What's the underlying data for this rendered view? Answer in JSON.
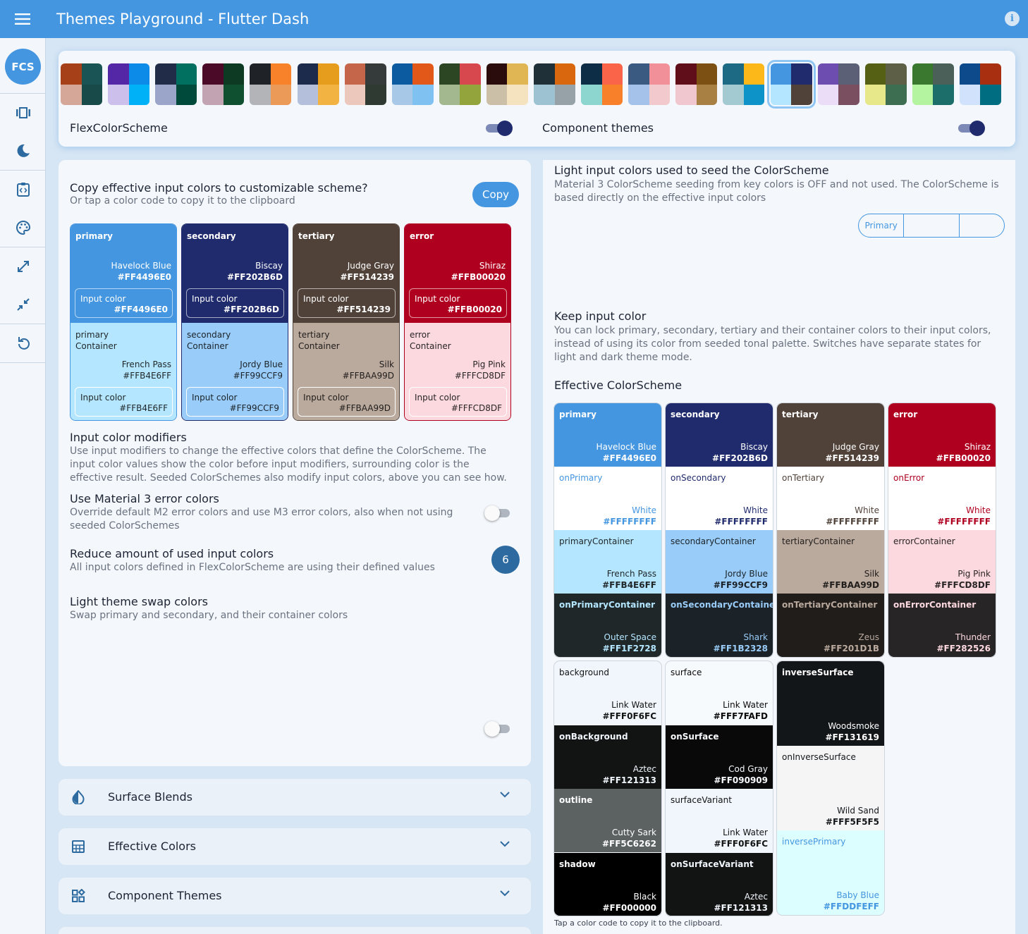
{
  "app": {
    "title": "Themes Playground - Flutter Dash",
    "logo": "FCS"
  },
  "icons": {
    "menu": "menu-icon",
    "info": "info-icon",
    "rail": [
      "view-carousel-icon",
      "dark-mode-icon",
      "code-icon",
      "palette-icon",
      "expand-icon",
      "collapse-icon",
      "reset-icon"
    ]
  },
  "schemes": [
    [
      "#a54018",
      "#1a5454",
      "#d4a798",
      "#184a4a"
    ],
    [
      "#5427a6",
      "#0c8be8",
      "#cdbfec",
      "#00b1f8"
    ],
    [
      "#202c48",
      "#027060",
      "#9aa5c9",
      "#004a3c"
    ],
    [
      "#4b0a28",
      "#0c3a23",
      "#c1a3b1",
      "#0f5030"
    ],
    [
      "#1f2328",
      "#f8822a",
      "#b3b4b8",
      "#ec9a58"
    ],
    [
      "#1c2b4c",
      "#e69d1d",
      "#b4c0db",
      "#f2b342"
    ],
    [
      "#c5664b",
      "#343b3a",
      "#ecc8bc",
      "#2f3a33"
    ],
    [
      "#0c5aa0",
      "#e25818",
      "#a8c8e8",
      "#7fc1f0"
    ],
    [
      "#2c4624",
      "#d6484e",
      "#a3b88f",
      "#92a43b"
    ],
    [
      "#2b0c0c",
      "#e0b655",
      "#cbbfa8",
      "#f4e3be"
    ],
    [
      "#203038",
      "#d8670e",
      "#9dc2d1",
      "#96a2a8"
    ],
    [
      "#0c2d45",
      "#fa6448",
      "#8cd6cf",
      "#f9802a"
    ],
    [
      "#3a5a82",
      "#f2909a",
      "#a5c2eb",
      "#f2c9cd"
    ],
    [
      "#600e1a",
      "#7c5012",
      "#f0c7ce",
      "#a88044"
    ],
    [
      "#1c6a84",
      "#fbb818",
      "#a3c9d1",
      "#0d93c8"
    ],
    [
      "#4496e0",
      "#202b6d",
      "#b4e6ff",
      "#514239"
    ],
    [
      "#6d4db0",
      "#5c6076",
      "#ebdcf8",
      "#7a5060"
    ],
    [
      "#566014",
      "#5d6046",
      "#e6e88a",
      "#3e6e52"
    ],
    [
      "#3a7830",
      "#4a6058",
      "#b4f4a0",
      "#1b6e6a"
    ],
    [
      "#0c4a8c",
      "#a83010",
      "#d0e2fc",
      "#006e80"
    ]
  ],
  "selected_scheme": 15,
  "top": {
    "left_label": "FlexColorScheme",
    "right_label": "Component themes",
    "left_switch": true,
    "right_switch": true
  },
  "left": {
    "copy_title": "Copy effective input colors to customizable scheme?",
    "copy_sub": "Or tap a color code to copy it to the clipboard",
    "copy_button": "Copy",
    "input_colors": [
      {
        "name": "primary",
        "bg": "#4496e0",
        "fg": "#ffffff",
        "color_name": "Havelock Blue",
        "hex": "#FF4496E0",
        "input_label": "Input color",
        "input_hex": "#FF4496E0",
        "c_name": "primary\nContainer",
        "c_bg": "#b4e6ff",
        "c_fg": "#1f2728",
        "c_color_name": "French Pass",
        "c_hex": "#FFB4E6FF",
        "c_input_label": "Input color",
        "c_input_hex": "#FFB4E6FF"
      },
      {
        "name": "secondary",
        "bg": "#202b6d",
        "fg": "#ffffff",
        "color_name": "Biscay",
        "hex": "#FF202B6D",
        "input_label": "Input color",
        "input_hex": "#FF202B6D",
        "c_name": "secondary\nContainer",
        "c_bg": "#99ccf9",
        "c_fg": "#1b2328",
        "c_color_name": "Jordy Blue",
        "c_hex": "#FF99CCF9",
        "c_input_label": "Input color",
        "c_input_hex": "#FF99CCF9"
      },
      {
        "name": "tertiary",
        "bg": "#514239",
        "fg": "#ffffff",
        "color_name": "Judge Gray",
        "hex": "#FF514239",
        "input_label": "Input color",
        "input_hex": "#FF514239",
        "c_name": "tertiary\nContainer",
        "c_bg": "#baa99d",
        "c_fg": "#201d1b",
        "c_color_name": "Silk",
        "c_hex": "#FFBAA99D",
        "c_input_label": "Input color",
        "c_input_hex": "#FFBAA99D"
      },
      {
        "name": "error",
        "bg": "#b00020",
        "fg": "#ffffff",
        "color_name": "Shiraz",
        "hex": "#FFB00020",
        "input_label": "Input color",
        "input_hex": "#FFB00020",
        "c_name": "error\nContainer",
        "c_bg": "#fcd8df",
        "c_fg": "#282526",
        "c_color_name": "Pig Pink",
        "c_hex": "#FFFCD8DF",
        "c_input_label": "Input color",
        "c_input_hex": "#FFFCD8DF"
      }
    ],
    "modifiers_title": "Input color modifiers",
    "modifiers_sub": "Use input modifiers to change the effective colors that define the ColorScheme. The input color values show the color before input modifiers, surrounding color is the effective result. Seeded ColorSchemes also modify input colors, above you can see how.",
    "m3_title": "Use Material 3 error colors",
    "m3_sub": "Override default M2 error colors and use M3 error colors, also when not using seeded ColorSchemes",
    "m3_switch": false,
    "reduce_title": "Reduce amount of used input colors",
    "reduce_sub": "All input colors defined in FlexColorScheme are using their defined values",
    "reduce_value": "6",
    "swap_title": "Light theme swap colors",
    "swap_sub": "Swap primary and secondary, and their container colors",
    "swap_switch": false
  },
  "panels": [
    {
      "label": "Surface Blends",
      "icon": "opacity-icon"
    },
    {
      "label": "Effective Colors",
      "icon": "grid-icon"
    },
    {
      "label": "Component Themes",
      "icon": "widgets-icon"
    }
  ],
  "right": {
    "seed_title": "Light input colors used to seed the ColorScheme",
    "seed_sub": "Material 3 ColorScheme seeding from key colors is OFF and not used. The ColorScheme is based directly on the effective input colors",
    "seed_buttons": [
      "Primary",
      "",
      ""
    ],
    "keep_title": "Keep input color",
    "keep_sub": "You can lock primary, secondary, tertiary and their container colors to their input colors, instead of using its color from seeded tonal palette. Switches have separate states for light and dark theme mode.",
    "effective_title": "Effective ColorScheme",
    "tap_note": "Tap a color code to copy it to the clipboard.",
    "scheme_grid": [
      [
        {
          "name": "primary",
          "bg": "#4496e0",
          "fg": "#ffffff",
          "bold": true,
          "color_name": "Havelock Blue",
          "hex": "#FF4496E0"
        },
        {
          "name": "onPrimary",
          "bg": "#ffffff",
          "fg": "#4496e0",
          "bold": false,
          "color_name": "White",
          "hex": "#FFFFFFFF"
        },
        {
          "name": "primaryContainer",
          "bg": "#b4e6ff",
          "fg": "#1f2728",
          "bold": false,
          "color_name": "French Pass",
          "hex": "#FFB4E6FF"
        },
        {
          "name": "onPrimaryContainer",
          "bg": "#1f2728",
          "fg": "#b4e6ff",
          "bold": true,
          "color_name": "Outer Space",
          "hex": "#FF1F2728"
        }
      ],
      [
        {
          "name": "secondary",
          "bg": "#202b6d",
          "fg": "#ffffff",
          "bold": true,
          "color_name": "Biscay",
          "hex": "#FF202B6D"
        },
        {
          "name": "onSecondary",
          "bg": "#ffffff",
          "fg": "#202b6d",
          "bold": false,
          "color_name": "White",
          "hex": "#FFFFFFFF"
        },
        {
          "name": "secondaryContainer",
          "bg": "#99ccf9",
          "fg": "#1b2328",
          "bold": false,
          "color_name": "Jordy Blue",
          "hex": "#FF99CCF9"
        },
        {
          "name": "onSecondaryContainer",
          "bg": "#1b2328",
          "fg": "#99ccf9",
          "bold": true,
          "color_name": "Shark",
          "hex": "#FF1B2328"
        }
      ],
      [
        {
          "name": "tertiary",
          "bg": "#514239",
          "fg": "#ffffff",
          "bold": true,
          "color_name": "Judge Gray",
          "hex": "#FF514239"
        },
        {
          "name": "onTertiary",
          "bg": "#ffffff",
          "fg": "#514239",
          "bold": false,
          "color_name": "White",
          "hex": "#FFFFFFFF"
        },
        {
          "name": "tertiaryContainer",
          "bg": "#baa99d",
          "fg": "#201d1b",
          "bold": false,
          "color_name": "Silk",
          "hex": "#FFBAA99D"
        },
        {
          "name": "onTertiaryContainer",
          "bg": "#201d1b",
          "fg": "#baa99d",
          "bold": true,
          "color_name": "Zeus",
          "hex": "#FF201D1B"
        }
      ],
      [
        {
          "name": "error",
          "bg": "#b00020",
          "fg": "#ffffff",
          "bold": true,
          "color_name": "Shiraz",
          "hex": "#FFB00020"
        },
        {
          "name": "onError",
          "bg": "#ffffff",
          "fg": "#b00020",
          "bold": false,
          "color_name": "White",
          "hex": "#FFFFFFFF"
        },
        {
          "name": "errorContainer",
          "bg": "#fcd8df",
          "fg": "#282526",
          "bold": false,
          "color_name": "Pig Pink",
          "hex": "#FFFCD8DF"
        },
        {
          "name": "onErrorContainer",
          "bg": "#282526",
          "fg": "#fcd8df",
          "bold": true,
          "color_name": "Thunder",
          "hex": "#FF282526"
        }
      ]
    ],
    "surface_grid": [
      [
        {
          "name": "background",
          "bg": "#f0f6fc",
          "fg": "#121313",
          "bold": false,
          "color_name": "Link Water",
          "hex": "#FFF0F6FC"
        },
        {
          "name": "onBackground",
          "bg": "#121313",
          "fg": "#f0f6fc",
          "bold": true,
          "color_name": "Aztec",
          "hex": "#FF121313"
        },
        {
          "name": "outline",
          "bg": "#5c6262",
          "fg": "#ffffff",
          "bold": true,
          "color_name": "Cutty Sark",
          "hex": "#FF5C6262"
        },
        {
          "name": "shadow",
          "bg": "#000000",
          "fg": "#ffffff",
          "bold": true,
          "color_name": "Black",
          "hex": "#FF000000"
        }
      ],
      [
        {
          "name": "surface",
          "bg": "#f7fafd",
          "fg": "#090909",
          "bold": false,
          "color_name": "Link Water",
          "hex": "#FFF7FAFD"
        },
        {
          "name": "onSurface",
          "bg": "#090909",
          "fg": "#f7fafd",
          "bold": true,
          "color_name": "Cod Gray",
          "hex": "#FF090909"
        },
        {
          "name": "surfaceVariant",
          "bg": "#f0f6fc",
          "fg": "#121313",
          "bold": false,
          "color_name": "Link Water",
          "hex": "#FFF0F6FC"
        },
        {
          "name": "onSurfaceVariant",
          "bg": "#121313",
          "fg": "#f0f6fc",
          "bold": true,
          "color_name": "Aztec",
          "hex": "#FF121313"
        }
      ],
      [
        {
          "name": "inverseSurface",
          "bg": "#131619",
          "fg": "#ffffff",
          "bold": true,
          "color_name": "Woodsmoke",
          "hex": "#FF131619"
        },
        {
          "name": "onInverseSurface",
          "bg": "#f5f5f5",
          "fg": "#131619",
          "bold": false,
          "color_name": "Wild Sand",
          "hex": "#FFF5F5F5"
        },
        {
          "name": "inversePrimary",
          "bg": "#ddfeff",
          "fg": "#4496e0",
          "bold": false,
          "color_name": "Baby Blue",
          "hex": "#FFDDFEFF"
        }
      ]
    ]
  }
}
